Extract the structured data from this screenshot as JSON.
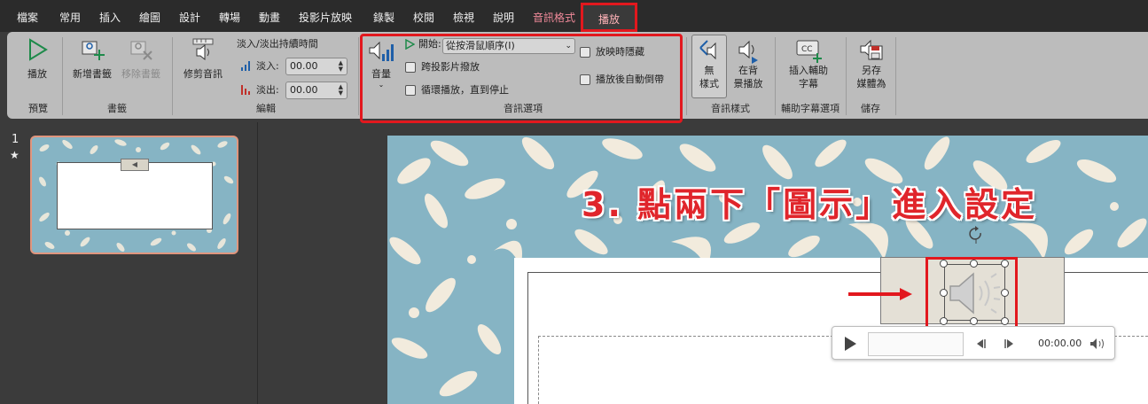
{
  "menu": {
    "tabs": [
      "檔案",
      "常用",
      "插入",
      "繪圖",
      "設計",
      "轉場",
      "動畫",
      "投影片放映",
      "錄製",
      "校閱",
      "檢視",
      "說明"
    ],
    "context_tab": "音訊格式",
    "active_tab": "播放"
  },
  "ribbon": {
    "preview": {
      "play_label": "播放",
      "group_label": "預覽"
    },
    "bookmarks": {
      "add_label": "新增書籤",
      "remove_label": "移除書籤",
      "group_label": "書籤"
    },
    "editing": {
      "trim_label": "修剪音訊",
      "fade_title": "淡入/淡出持續時間",
      "fade_in_label": "淡入:",
      "fade_in_value": "00.00",
      "fade_out_label": "淡出:",
      "fade_out_value": "00.00",
      "group_label": "編輯"
    },
    "audio_options": {
      "volume_label": "音量",
      "start_label": "開始:",
      "start_value": "從按滑鼠順序(I)",
      "play_across_slides": "跨投影片撥放",
      "loop_until_stopped": "循環播放，直到停止",
      "hide_during_show": "放映時隱藏",
      "rewind_after_playing": "播放後自動倒帶",
      "group_label": "音訊選項"
    },
    "audio_styles": {
      "no_style_label": [
        "無",
        "樣式"
      ],
      "bg_play_label": [
        "在背",
        "景播放"
      ],
      "group_label": "音訊樣式"
    },
    "captions": {
      "insert_label": [
        "插入輔助",
        "字幕"
      ],
      "group_label": "輔助字幕選項"
    },
    "save": {
      "save_as_label": [
        "另存",
        "媒體為"
      ],
      "group_label": "儲存"
    }
  },
  "slides_panel": {
    "number": "1",
    "star": "★"
  },
  "slide": {
    "instruction": "3. 點兩下「圖示」進入設定",
    "player": {
      "time": "00:00.00"
    }
  },
  "colors": {
    "highlight": "#e2181e",
    "slide_bg": "#86b4c4",
    "leaf": "#f2ebdd"
  }
}
